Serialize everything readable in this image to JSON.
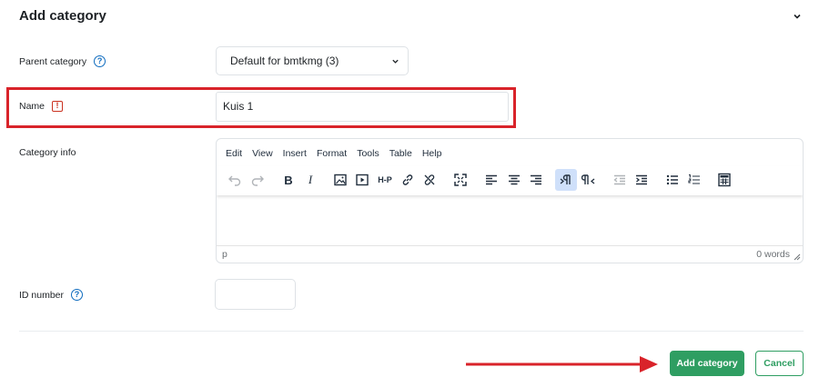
{
  "header": {
    "title": "Add category",
    "collapse_icon": "chevron-down-icon"
  },
  "fields": {
    "parent_category": {
      "label": "Parent category",
      "value": "Default for bmtkmg (3)",
      "help_icon": "?"
    },
    "name": {
      "label": "Name",
      "value": "Kuis 1",
      "required_icon": "!"
    },
    "category_info": {
      "label": "Category info"
    },
    "id_number": {
      "label": "ID number",
      "value": "",
      "help_icon": "?"
    }
  },
  "editor": {
    "menu": [
      "Edit",
      "View",
      "Insert",
      "Format",
      "Tools",
      "Table",
      "Help"
    ],
    "toolbar_icons": [
      "undo-icon",
      "redo-icon",
      "bold-icon",
      "italic-icon",
      "image-icon",
      "media-icon",
      "h5p-icon",
      "link-icon",
      "unlink-icon",
      "fullscreen-icon",
      "align-left-icon",
      "align-center-icon",
      "align-right-icon",
      "ltr-icon",
      "rtl-icon",
      "outdent-icon",
      "indent-icon",
      "bullet-list-icon",
      "numbered-list-icon",
      "calculator-icon"
    ],
    "bold_glyph": "B",
    "italic_glyph": "I",
    "h5p_glyph": "H-P",
    "status_path": "p",
    "word_count": "0 words"
  },
  "actions": {
    "submit_label": "Add category",
    "cancel_label": "Cancel"
  },
  "colors": {
    "accent_green": "#2f9e62",
    "highlight_red": "#d9232a",
    "help_blue": "#0f6cbf"
  }
}
